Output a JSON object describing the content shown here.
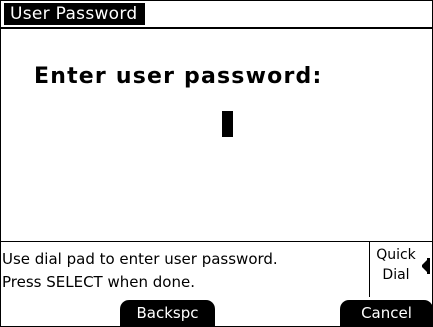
{
  "screen": {
    "title": "User Password",
    "prompt": "Enter user password:"
  },
  "message": {
    "line1": "Use dial pad to enter user password.",
    "line2": "Press SELECT when done."
  },
  "quick_dial": {
    "line1": "Quick",
    "line2": "Dial",
    "icon": "speaker-arrow-icon"
  },
  "softkeys": {
    "left": "Backspc",
    "right": "Cancel"
  },
  "colors": {
    "foreground": "#000000",
    "background": "#ffffff"
  }
}
